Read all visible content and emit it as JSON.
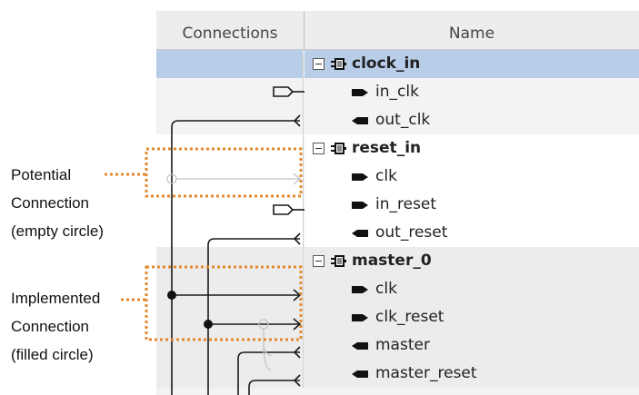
{
  "table": {
    "headers": {
      "connections": "Connections",
      "name": "Name"
    },
    "rows": [
      {
        "label": "clock_in",
        "kind": "module"
      },
      {
        "label": "in_clk",
        "kind": "sink"
      },
      {
        "label": "out_clk",
        "kind": "source"
      },
      {
        "label": "reset_in",
        "kind": "module"
      },
      {
        "label": "clk",
        "kind": "sink"
      },
      {
        "label": "in_reset",
        "kind": "sink"
      },
      {
        "label": "out_reset",
        "kind": "source"
      },
      {
        "label": "master_0",
        "kind": "module"
      },
      {
        "label": "clk",
        "kind": "sink"
      },
      {
        "label": "clk_reset",
        "kind": "sink"
      },
      {
        "label": "master",
        "kind": "source"
      },
      {
        "label": "master_reset",
        "kind": "source"
      }
    ]
  },
  "annotations": {
    "potential": {
      "line1": "Potential",
      "line2": "Connection",
      "line3": "(empty circle)"
    },
    "implemented": {
      "line1": "Implemented",
      "line2": "Connection",
      "line3": "(filled circle)"
    }
  },
  "colors": {
    "highlight": "#e58a2c",
    "selected_row": "#b7cde8"
  }
}
